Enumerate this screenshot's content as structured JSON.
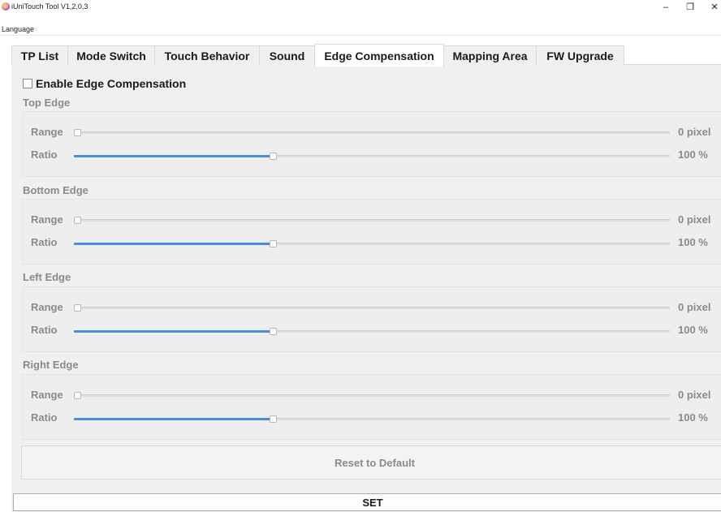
{
  "window": {
    "title": "iUniTouch Tool V1,2,0,3",
    "minimize_glyph": "–",
    "maximize_glyph": "❐",
    "close_glyph": "✕"
  },
  "menu": {
    "language": "Language"
  },
  "tabs": [
    {
      "label": "TP List",
      "active": false
    },
    {
      "label": "Mode Switch",
      "active": false
    },
    {
      "label": "Touch Behavior",
      "active": false
    },
    {
      "label": "Sound",
      "active": false
    },
    {
      "label": "Edge Compensation",
      "active": true
    },
    {
      "label": "Mapping Area",
      "active": false
    },
    {
      "label": "FW Upgrade",
      "active": false
    }
  ],
  "enable": {
    "label": "Enable Edge Compensation",
    "checked": false
  },
  "groups": [
    {
      "title": "Top Edge",
      "range": {
        "label": "Range",
        "value_text": "0 pixel",
        "fraction": 0
      },
      "ratio": {
        "label": "Ratio",
        "value_text": "100 %",
        "fraction": 0.333
      }
    },
    {
      "title": "Bottom Edge",
      "range": {
        "label": "Range",
        "value_text": "0 pixel",
        "fraction": 0
      },
      "ratio": {
        "label": "Ratio",
        "value_text": "100 %",
        "fraction": 0.333
      }
    },
    {
      "title": "Left Edge",
      "range": {
        "label": "Range",
        "value_text": "0 pixel",
        "fraction": 0
      },
      "ratio": {
        "label": "Ratio",
        "value_text": "100 %",
        "fraction": 0.333
      }
    },
    {
      "title": "Right Edge",
      "range": {
        "label": "Range",
        "value_text": "0 pixel",
        "fraction": 0
      },
      "ratio": {
        "label": "Ratio",
        "value_text": "100 %",
        "fraction": 0.333
      }
    }
  ],
  "buttons": {
    "reset": "Reset to Default",
    "set": "SET"
  },
  "colors": {
    "slider_fill": "#4b8fdc",
    "panel_bg": "#f0f0f0",
    "disabled_text": "#8a8a8a"
  }
}
